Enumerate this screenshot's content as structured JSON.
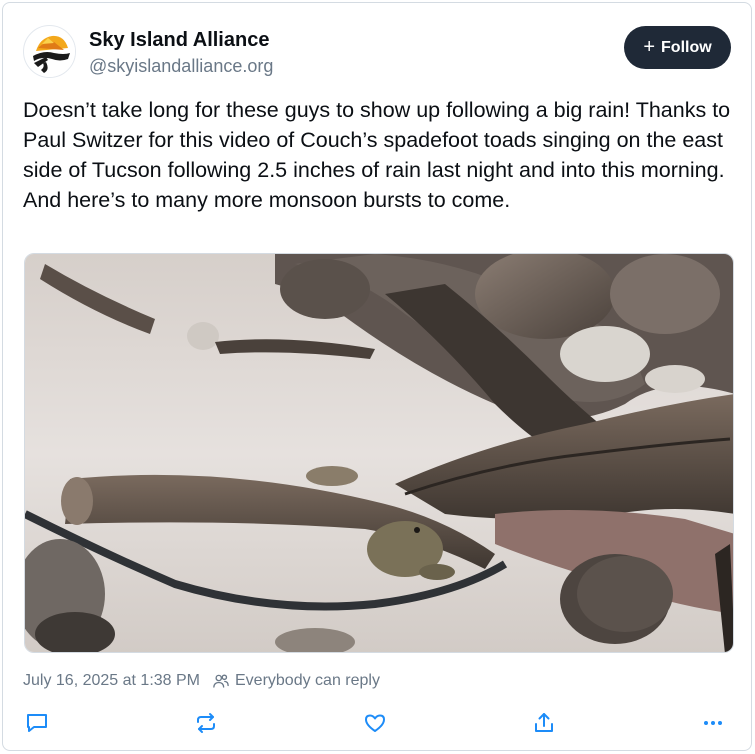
{
  "post": {
    "author": {
      "display_name": "Sky Island Alliance",
      "handle": "@skyislandalliance.org",
      "avatar_icon": "sky-island-alliance-logo"
    },
    "follow_button": {
      "icon": "plus-icon",
      "label": "Follow"
    },
    "text": "Doesn’t take long for these guys to show up following a big rain! Thanks to Paul Switzer for this video of Couch’s spadefoot toads singing on the east side of Tucson following 2.5 inches of rain last night and into this morning. And here’s to many more monsoon bursts to come.",
    "media": {
      "type": "video-thumbnail",
      "subject": "toads in a rain puddle"
    },
    "meta": {
      "timestamp": "July 16, 2025 at 1:38 PM",
      "reply_setting": "Everybody can reply"
    },
    "actions": [
      "reply-icon",
      "repost-icon",
      "like-icon",
      "share-icon",
      "more-icon"
    ]
  },
  "colors": {
    "text_primary": "#0b0f14",
    "text_secondary": "#6a7887",
    "follow_bg": "#1f2937",
    "icon": "#1d8cf8"
  }
}
